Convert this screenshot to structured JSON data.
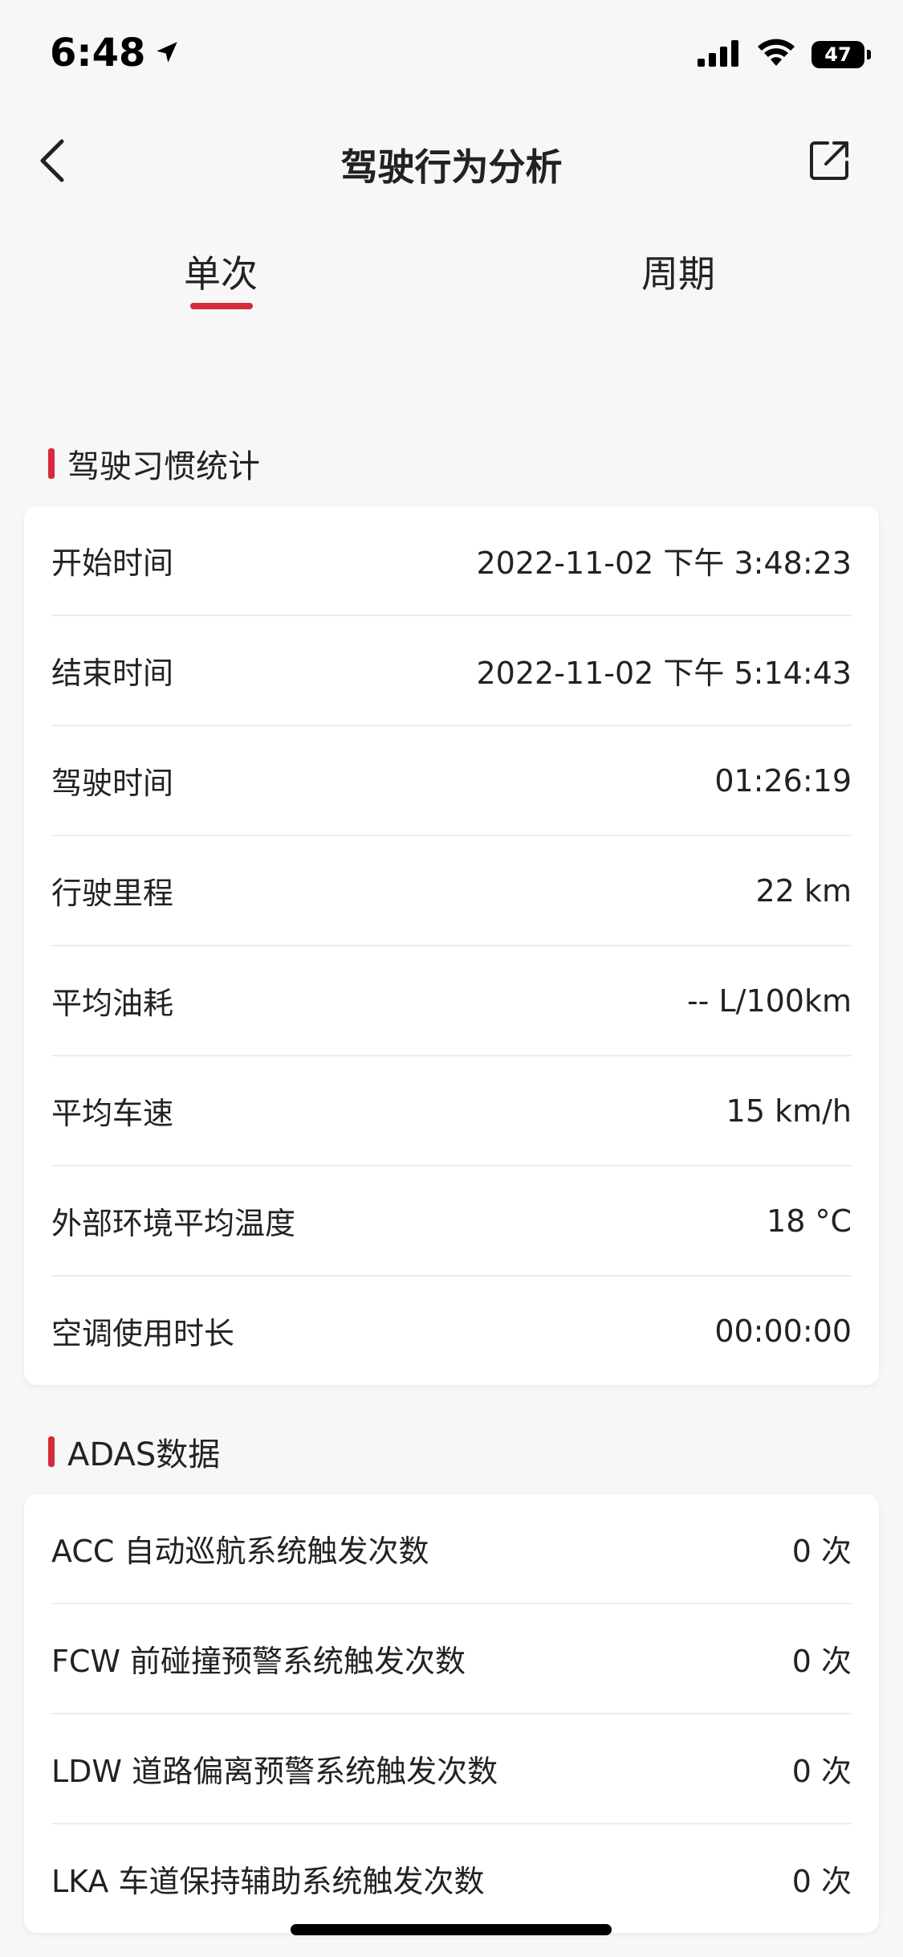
{
  "status": {
    "time": "6:48",
    "battery": "47"
  },
  "nav": {
    "title": "驾驶行为分析"
  },
  "tabs": [
    {
      "label": "单次",
      "active": true
    },
    {
      "label": "周期",
      "active": false
    }
  ],
  "accent_color": "#d62b3a",
  "habits": {
    "title": "驾驶习惯统计",
    "rows": [
      {
        "label": "开始时间",
        "value": "2022-11-02 下午 3:48:23"
      },
      {
        "label": "结束时间",
        "value": "2022-11-02 下午 5:14:43"
      },
      {
        "label": "驾驶时间",
        "value": "01:26:19"
      },
      {
        "label": "行驶里程",
        "value": "22 km"
      },
      {
        "label": "平均油耗",
        "value": "-- L/100km"
      },
      {
        "label": "平均车速",
        "value": "15 km/h"
      },
      {
        "label": "外部环境平均温度",
        "value": "18 °C"
      },
      {
        "label": "空调使用时长",
        "value": "00:00:00"
      }
    ]
  },
  "adas": {
    "title": "ADAS数据",
    "rows": [
      {
        "label": "ACC 自动巡航系统触发次数",
        "value": "0 次"
      },
      {
        "label": "FCW 前碰撞预警系统触发次数",
        "value": "0 次"
      },
      {
        "label": "LDW 道路偏离预警系统触发次数",
        "value": "0 次"
      },
      {
        "label": "LKA 车道保持辅助系统触发次数",
        "value": "0 次"
      }
    ]
  }
}
